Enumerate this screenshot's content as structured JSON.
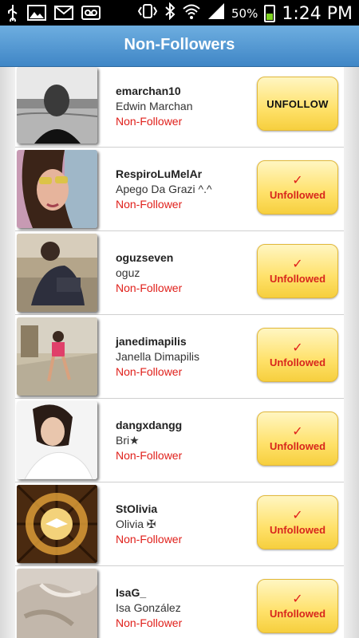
{
  "status_bar": {
    "left_icons": [
      "usb-icon",
      "image-icon",
      "gmail-icon",
      "voicemail-icon"
    ],
    "right_icons": [
      "vibrate-icon",
      "bluetooth-icon",
      "wifi-icon",
      "signal-icon"
    ],
    "battery": "50%",
    "time": "1:24 PM"
  },
  "header": {
    "title": "Non-Followers"
  },
  "colors": {
    "header_top": "#6eaee0",
    "header_bottom": "#3f86c6",
    "button_yellow": "#ffe16a",
    "status_red": "#e0201b"
  },
  "rows": [
    {
      "username": "emarchan10",
      "fullname": "Edwin Marchan",
      "status": "Non-Follower",
      "action": "UNFOLLOW",
      "unfollowed": false,
      "avatar": "bw-portrait-man-photo"
    },
    {
      "username": "RespiroLuMelAr",
      "fullname": "Apego Da Grazi ^.^",
      "status": "Non-Follower",
      "action": "Unfollowed",
      "unfollowed": true,
      "avatar": "selfie-woman-sunglasses-photo"
    },
    {
      "username": "oguzseven",
      "fullname": "oguz",
      "status": "Non-Follower",
      "action": "Unfollowed",
      "unfollowed": true,
      "avatar": "man-sitting-photo"
    },
    {
      "username": "janedimapilis",
      "fullname": "Janella Dimapilis",
      "status": "Non-Follower",
      "action": "Unfollowed",
      "unfollowed": true,
      "avatar": "woman-walking-street-photo"
    },
    {
      "username": "dangxdangg",
      "fullname": "Bri★",
      "status": "Non-Follower",
      "action": "Unfollowed",
      "unfollowed": true,
      "avatar": "girl-portrait-photo"
    },
    {
      "username": "StOlivia",
      "fullname": "Olivia ✠",
      "status": "Non-Follower",
      "action": "Unfollowed",
      "unfollowed": true,
      "avatar": "stained-glass-dove-image"
    },
    {
      "username": "IsaG_",
      "fullname": "Isa González",
      "status": "Non-Follower",
      "action": "Unfollowed",
      "unfollowed": true,
      "avatar": "dog-closeup-photo"
    }
  ],
  "check_mark": "✓"
}
